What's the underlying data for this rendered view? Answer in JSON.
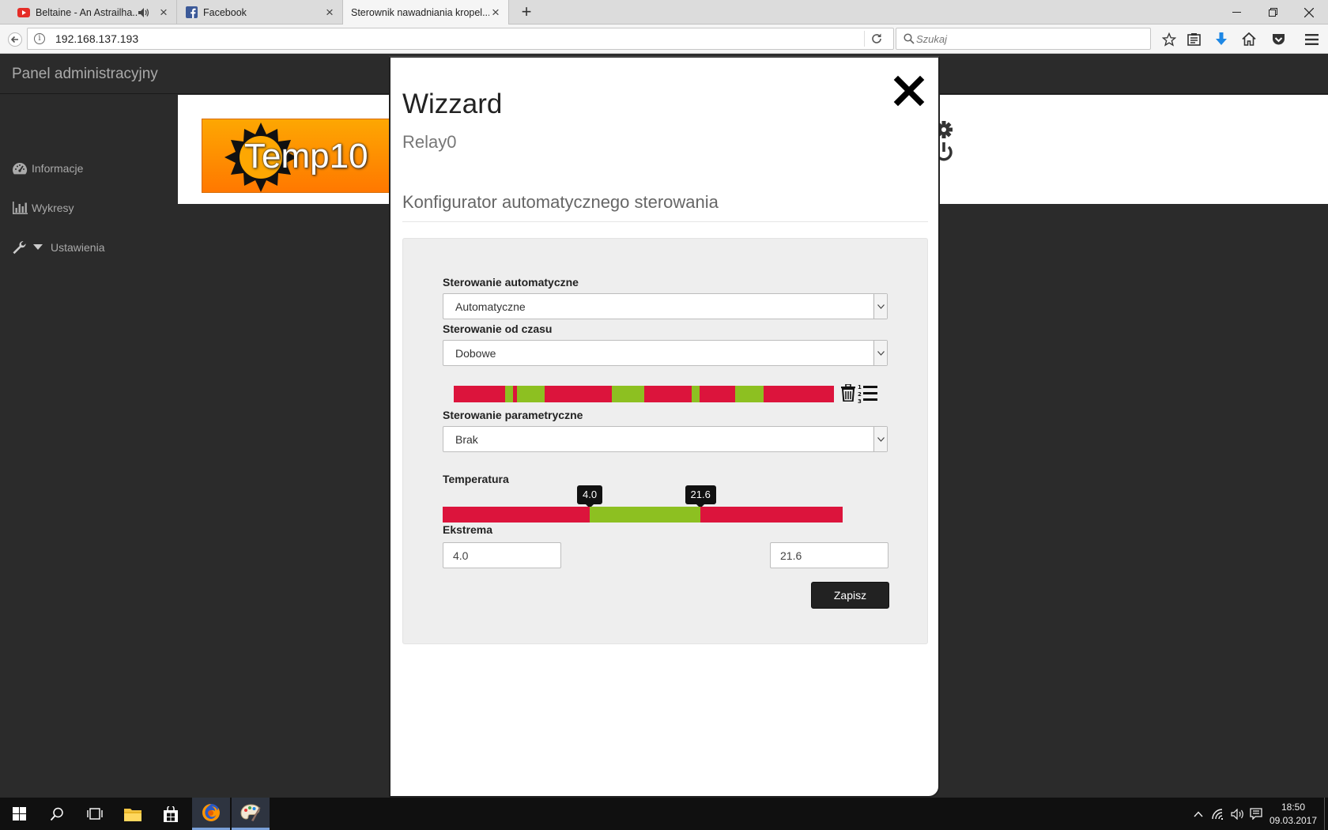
{
  "browser": {
    "tabs": [
      {
        "title": "Beltaine - An Astrailha...",
        "favicon": "youtube-icon",
        "audio": true
      },
      {
        "title": "Facebook",
        "favicon": "facebook-icon",
        "audio": false
      },
      {
        "title": "Sterownik nawadniania kropel...",
        "favicon": "none",
        "audio": false,
        "active": true
      }
    ],
    "url": "192.168.137.193",
    "search_placeholder": "Szukaj"
  },
  "app": {
    "title": "Panel administracyjny",
    "sidebar": [
      {
        "label": "Informacje",
        "icon": "dashboard-icon"
      },
      {
        "label": "Wykresy",
        "icon": "bar-chart-icon"
      },
      {
        "label": "Ustawienia",
        "icon": "wrench-icon"
      }
    ],
    "device_name": "Temp10"
  },
  "modal": {
    "title": "Wizzard",
    "subtitle": "Relay0",
    "section_title": "Konfigurator automatycznego sterowania",
    "auto_control": {
      "label": "Sterowanie automatyczne",
      "value": "Automatyczne"
    },
    "time_control": {
      "label": "Sterowanie od czasu",
      "value": "Dobowe"
    },
    "time_schedule": {
      "active_color": "#8dc021",
      "inactive_color": "#dc143c",
      "active_segments": [
        [
          0.135,
          0.155
        ],
        [
          0.165,
          0.24
        ],
        [
          0.415,
          0.5
        ],
        [
          0.625,
          0.645
        ],
        [
          0.74,
          0.815
        ]
      ],
      "marker_segments": [
        [
          0.157,
          0.163
        ]
      ]
    },
    "param_control": {
      "label": "Sterowanie parametryczne",
      "value": "Brak"
    },
    "temperature": {
      "label": "Temperatura",
      "min_value": "4.0",
      "max_value": "21.6",
      "range_start": 0.367,
      "range_end": 0.645
    },
    "extrema": {
      "label": "Ekstrema",
      "min": "4.0",
      "max": "21.6"
    },
    "save_label": "Zapisz"
  },
  "taskbar": {
    "date": "09.03.2017",
    "time": "18:50"
  },
  "colors": {
    "accent_green": "#8dc021",
    "accent_red": "#dc143c",
    "banner_orange": "#ff9000",
    "app_dark": "#2b2b2b"
  }
}
